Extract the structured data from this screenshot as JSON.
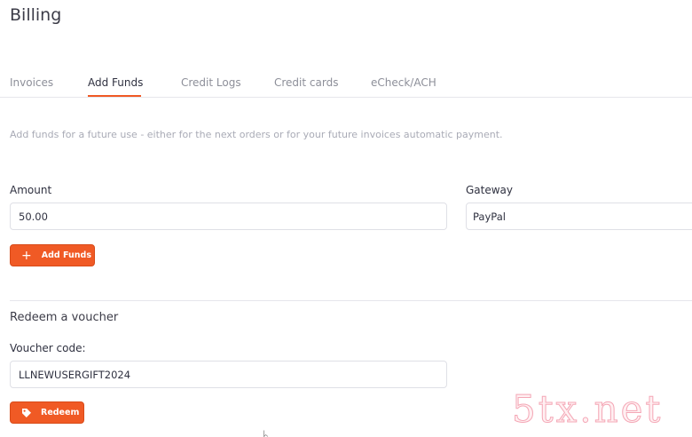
{
  "page": {
    "title": "Billing"
  },
  "tabs": [
    {
      "label": "Invoices",
      "active": false
    },
    {
      "label": "Add Funds",
      "active": true
    },
    {
      "label": "Credit Logs",
      "active": false
    },
    {
      "label": "Credit cards",
      "active": false
    },
    {
      "label": "eCheck/ACH",
      "active": false
    }
  ],
  "add_funds": {
    "description": "Add funds for a future use - either for the next orders or for your future invoices automatic payment.",
    "amount_label": "Amount",
    "amount_value": "50.00",
    "gateway_label": "Gateway",
    "gateway_value": "PayPal",
    "button_label": "Add Funds",
    "button_icon": "plus-icon"
  },
  "voucher": {
    "section_title": "Redeem a voucher",
    "code_label": "Voucher code:",
    "code_value": "LLNEWUSERGIFT2024",
    "button_label": "Redeem",
    "button_icon": "tag-icon"
  },
  "watermark": {
    "text": "5tx.net"
  },
  "colors": {
    "accent": "#f05a25",
    "text": "#2f3140",
    "muted": "#8d8f99",
    "border": "#dfe0e6"
  }
}
